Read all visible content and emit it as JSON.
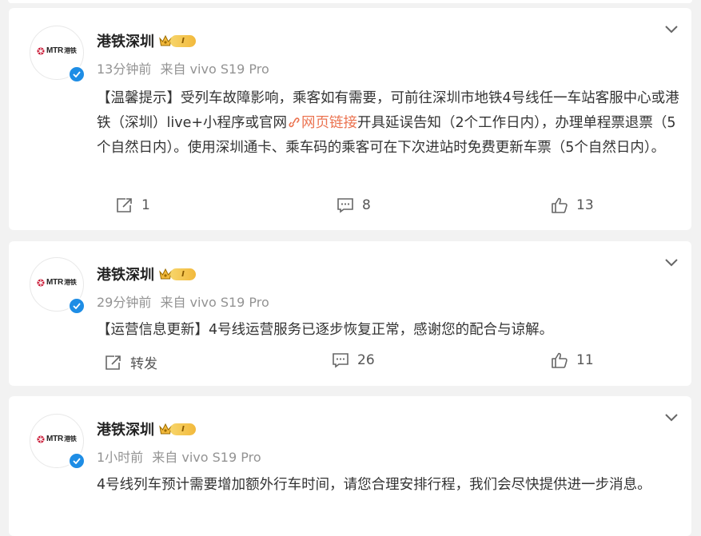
{
  "colors": {
    "link": "#eb7350",
    "verified": "#1e8de5",
    "muted": "#939393"
  },
  "posts": [
    {
      "author": "港铁深圳",
      "level": "I",
      "avatar_logo": "MTR",
      "avatar_logo_cn": "港铁",
      "time": "13分钟前",
      "source": "来自 vivo S19 Pro",
      "text_before": "【温馨提示】受列车故障影响，乘客如有需要，可前往深圳市地铁4号线任一车站客服中心或港铁（深圳）live+小程序或官网",
      "link_icon": "link-icon",
      "link_text": "网页链接",
      "text_after": "开具延误告知（2个工作日内），办理单程票退票（5个自然日内）。使用深圳通卡、乘车码的乘客可在下次进站时免费更新车票（5个自然日内）。",
      "repost": "1",
      "comments": "8",
      "likes": "13"
    },
    {
      "author": "港铁深圳",
      "level": "I",
      "avatar_logo": "MTR",
      "avatar_logo_cn": "港铁",
      "time": "29分钟前",
      "source": "来自 vivo S19 Pro",
      "text": "【运营信息更新】4号线运营服务已逐步恢复正常，感谢您的配合与谅解。",
      "repost": "转发",
      "comments": "26",
      "likes": "11"
    },
    {
      "author": "港铁深圳",
      "level": "I",
      "avatar_logo": "MTR",
      "avatar_logo_cn": "港铁",
      "time": "1小时前",
      "source": "来自 vivo S19 Pro",
      "text": "4号线列车预计需要增加额外行车时间，请您合理安排行程，我们会尽快提供进一步消息。"
    }
  ]
}
